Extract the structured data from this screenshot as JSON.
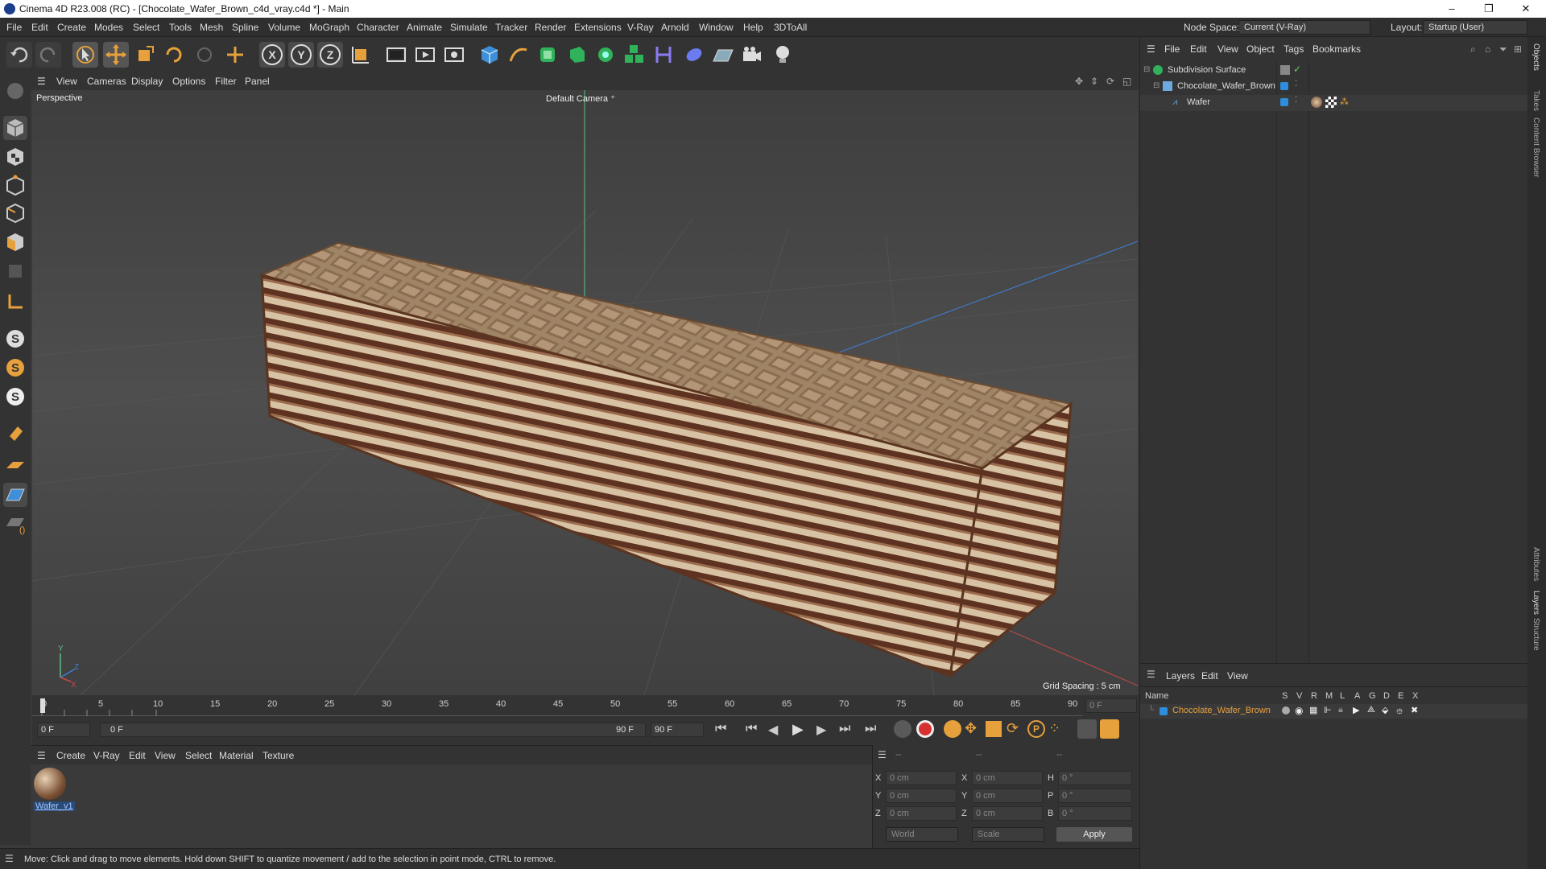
{
  "window": {
    "title": "Cinema 4D R23.008 (RC) - [Chocolate_Wafer_Brown_c4d_vray.c4d *] - Main",
    "minimize": "–",
    "maximize": "❐",
    "close": "✕"
  },
  "menubar": {
    "items": [
      "File",
      "Edit",
      "Create",
      "Modes",
      "Select",
      "Tools",
      "Mesh",
      "Spline",
      "Volume",
      "MoGraph",
      "Character",
      "Animate",
      "Simulate",
      "Tracker",
      "Render",
      "Extensions",
      "V-Ray",
      "Arnold",
      "Window",
      "Help",
      "3DToAll"
    ],
    "node_space_label": "Node Space:",
    "node_space_value": "Current (V-Ray)",
    "layout_label": "Layout:",
    "layout_value": "Startup (User)"
  },
  "viewport": {
    "menu": [
      "View",
      "Cameras",
      "Display",
      "Options",
      "Filter",
      "Panel"
    ],
    "view_name": "Perspective",
    "camera": "Default Camera",
    "grid_spacing": "Grid Spacing : 5 cm"
  },
  "timeline": {
    "ticks": [
      "0",
      "5",
      "10",
      "15",
      "20",
      "25",
      "30",
      "35",
      "40",
      "45",
      "50",
      "55",
      "60",
      "65",
      "70",
      "75",
      "80",
      "85",
      "90"
    ],
    "current_frame": "0 F",
    "start_field": "0 F",
    "range_start": "0 F",
    "range_end": "90 F",
    "end_field": "90 F"
  },
  "material_manager": {
    "menu": [
      "Create",
      "V-Ray",
      "Edit",
      "View",
      "Select",
      "Material",
      "Texture"
    ],
    "materials": [
      {
        "name": "Wafer_v1"
      }
    ]
  },
  "coordinates": {
    "headers": [
      "--",
      "--",
      "--"
    ],
    "rows": [
      {
        "l1": "X",
        "v1": "0 cm",
        "l2": "X",
        "v2": "0 cm",
        "l3": "H",
        "v3": "0 °"
      },
      {
        "l1": "Y",
        "v1": "0 cm",
        "l2": "Y",
        "v2": "0 cm",
        "l3": "P",
        "v3": "0 °"
      },
      {
        "l1": "Z",
        "v1": "0 cm",
        "l2": "Z",
        "v2": "0 cm",
        "l3": "B",
        "v3": "0 °"
      }
    ],
    "space": "World",
    "mode": "Scale",
    "apply": "Apply"
  },
  "status": {
    "text": "Move: Click and drag to move elements. Hold down SHIFT to quantize movement / add to the selection in point mode, CTRL to remove."
  },
  "object_manager": {
    "menu": [
      "File",
      "Edit",
      "View",
      "Object",
      "Tags",
      "Bookmarks"
    ],
    "objects": [
      {
        "name": "Subdivision Surface"
      },
      {
        "name": "Chocolate_Wafer_Brown"
      },
      {
        "name": "Wafer"
      }
    ]
  },
  "layer_manager": {
    "menu": [
      "Layers",
      "Edit",
      "View"
    ],
    "name_header": "Name",
    "col_headers": [
      "S",
      "V",
      "R",
      "M",
      "L",
      "A",
      "G",
      "D",
      "E",
      "X"
    ],
    "layers": [
      {
        "name": "Chocolate_Wafer_Brown",
        "color": "#2e8ddc"
      }
    ]
  },
  "right_tabs": [
    "Objects",
    "Takes",
    "Content Browser",
    "Attributes",
    "Layers",
    "Structure"
  ],
  "colors": {
    "accent": "#e6a03c",
    "layer_name": "#e6a03c",
    "selection_blue": "#2e8ddc"
  }
}
